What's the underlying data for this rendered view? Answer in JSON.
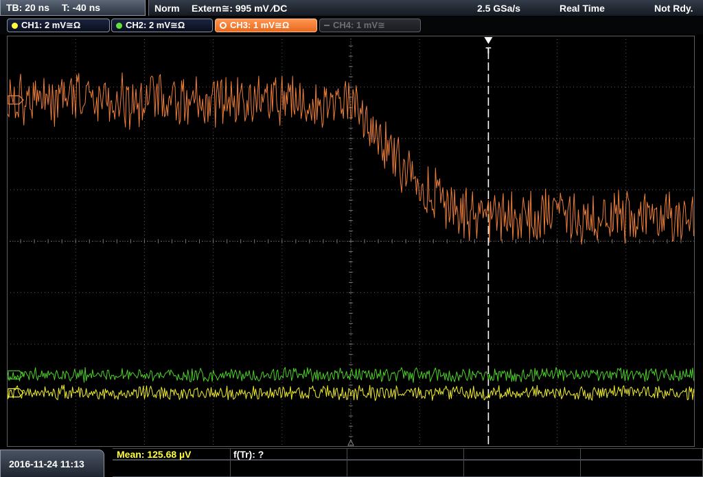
{
  "status": {
    "timebase": "TB: 20 ns",
    "trigger_time": "T: -40 ns",
    "trigger_mode": "Norm",
    "trigger_source": "Extern≅: 995 mV ∕DC",
    "sample_rate": "2.5 GSa/s",
    "acquisition": "Real Time",
    "state": "Not Rdy."
  },
  "channels": [
    {
      "label": "CH1: 2 mV≅Ω",
      "color": "#ffff44",
      "state": "on"
    },
    {
      "label": "CH2: 2 mV≅Ω",
      "color": "#5fe23a",
      "state": "on"
    },
    {
      "label": "CH3: 1 mV≅Ω",
      "color": "#ff8a3d",
      "state": "active"
    },
    {
      "label": "CH4: 1 mV≅",
      "color": "#6b6f76",
      "state": "off"
    }
  ],
  "markers": {
    "trigger_label": "T"
  },
  "measurements": {
    "mean": "Mean: 125.68 µV",
    "ftr": "f(Tr): ?"
  },
  "datetime": "2016-11-24 11:13",
  "colors": {
    "ch1": "#f2ef2a",
    "ch2": "#4cd427",
    "ch3": "#f0803a",
    "grid": "#5a5a5a",
    "meas_label": "#ffff3a"
  },
  "chart_data": {
    "type": "line",
    "x_divisions": 10,
    "y_divisions": 8,
    "trigger_x_division": 7,
    "series": [
      {
        "name": "CH3",
        "color": "#f0803a",
        "y_division_start": 1.25,
        "y_division_end": 3.55,
        "step_at_division": 5.0,
        "noise_divisions": 0.45
      },
      {
        "name": "CH2",
        "color": "#4cd427",
        "y_division": 6.6,
        "noise_divisions": 0.12
      },
      {
        "name": "CH1",
        "color": "#f2ef2a",
        "y_division": 6.95,
        "noise_divisions": 0.12
      }
    ]
  }
}
